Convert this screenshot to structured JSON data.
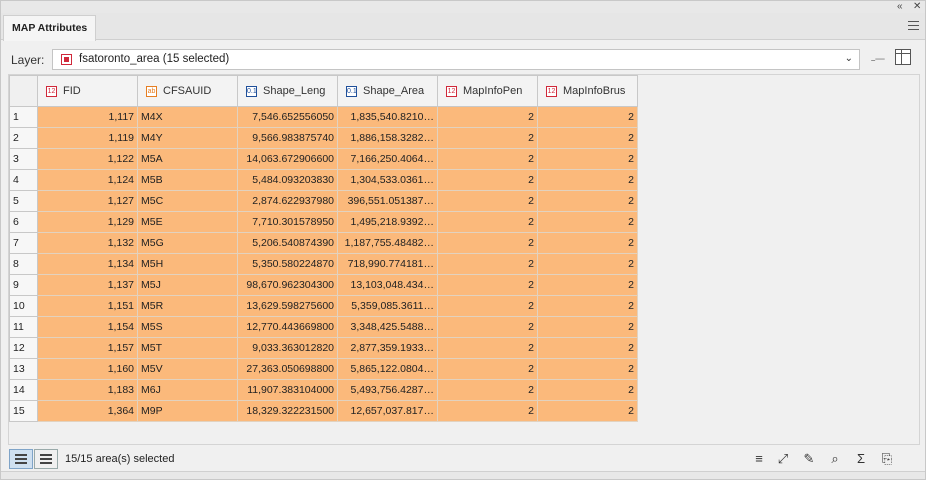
{
  "panel": {
    "tab_title": "MAP Attributes",
    "collapse_label": "«",
    "close_label": "✕"
  },
  "layer": {
    "label": "Layer:",
    "value": "fsatoronto_area (15 selected)"
  },
  "table": {
    "columns": [
      {
        "label": "FID",
        "type_icon": "integer-field-icon",
        "type_glyph": "12"
      },
      {
        "label": "CFSAUID",
        "type_icon": "string-field-icon",
        "type_glyph": "ab"
      },
      {
        "label": "Shape_Leng",
        "type_icon": "double-field-icon",
        "type_glyph": "0.1"
      },
      {
        "label": "Shape_Area",
        "type_icon": "double-field-icon",
        "type_glyph": "0.1"
      },
      {
        "label": "MapInfoPen",
        "type_icon": "integer-field-icon",
        "type_glyph": "12"
      },
      {
        "label": "MapInfoBrus",
        "type_icon": "integer-field-icon",
        "type_glyph": "12"
      }
    ],
    "rows": [
      {
        "n": "1",
        "fid": "1,117",
        "cfsauid": "M4X",
        "leng": "7,546.652556050",
        "area": "1,835,540.8210…",
        "pen": "2",
        "brush": "2"
      },
      {
        "n": "2",
        "fid": "1,119",
        "cfsauid": "M4Y",
        "leng": "9,566.983875740",
        "area": "1,886,158.3282…",
        "pen": "2",
        "brush": "2"
      },
      {
        "n": "3",
        "fid": "1,122",
        "cfsauid": "M5A",
        "leng": "14,063.672906600",
        "area": "7,166,250.4064…",
        "pen": "2",
        "brush": "2"
      },
      {
        "n": "4",
        "fid": "1,124",
        "cfsauid": "M5B",
        "leng": "5,484.093203830",
        "area": "1,304,533.0361…",
        "pen": "2",
        "brush": "2"
      },
      {
        "n": "5",
        "fid": "1,127",
        "cfsauid": "M5C",
        "leng": "2,874.622937980",
        "area": "396,551.051387…",
        "pen": "2",
        "brush": "2"
      },
      {
        "n": "6",
        "fid": "1,129",
        "cfsauid": "M5E",
        "leng": "7,710.301578950",
        "area": "1,495,218.9392…",
        "pen": "2",
        "brush": "2"
      },
      {
        "n": "7",
        "fid": "1,132",
        "cfsauid": "M5G",
        "leng": "5,206.540874390",
        "area": "1,187,755.48482…",
        "pen": "2",
        "brush": "2"
      },
      {
        "n": "8",
        "fid": "1,134",
        "cfsauid": "M5H",
        "leng": "5,350.580224870",
        "area": "718,990.774181…",
        "pen": "2",
        "brush": "2"
      },
      {
        "n": "9",
        "fid": "1,137",
        "cfsauid": "M5J",
        "leng": "98,670.962304300",
        "area": "13,103,048.434…",
        "pen": "2",
        "brush": "2"
      },
      {
        "n": "10",
        "fid": "1,151",
        "cfsauid": "M5R",
        "leng": "13,629.598275600",
        "area": "5,359,085.3611…",
        "pen": "2",
        "brush": "2"
      },
      {
        "n": "11",
        "fid": "1,154",
        "cfsauid": "M5S",
        "leng": "12,770.443669800",
        "area": "3,348,425.5488…",
        "pen": "2",
        "brush": "2"
      },
      {
        "n": "12",
        "fid": "1,157",
        "cfsauid": "M5T",
        "leng": "9,033.363012820",
        "area": "2,877,359.1933…",
        "pen": "2",
        "brush": "2"
      },
      {
        "n": "13",
        "fid": "1,160",
        "cfsauid": "M5V",
        "leng": "27,363.050698800",
        "area": "5,865,122.0804…",
        "pen": "2",
        "brush": "2"
      },
      {
        "n": "14",
        "fid": "1,183",
        "cfsauid": "M6J",
        "leng": "11,907.383104000",
        "area": "5,493,756.4287…",
        "pen": "2",
        "brush": "2"
      },
      {
        "n": "15",
        "fid": "1,364",
        "cfsauid": "M9P",
        "leng": "18,329.322231500",
        "area": "12,657,037.817…",
        "pen": "2",
        "brush": "2"
      }
    ]
  },
  "status": {
    "text": "15/15 area(s) selected"
  },
  "colors": {
    "selected_row": "#fbb97b",
    "accent": "#1f4f9a"
  }
}
